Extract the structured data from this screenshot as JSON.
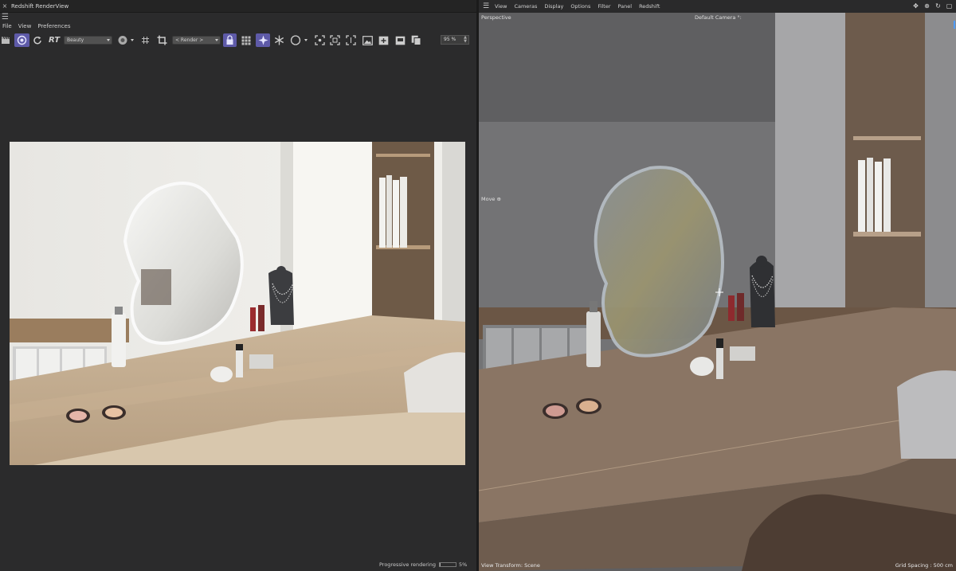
{
  "render_view": {
    "close_glyph": "×",
    "title": "Redshift RenderView",
    "menu": [
      "File",
      "View",
      "Preferences"
    ],
    "toolbar": {
      "rt_label": "RT",
      "aov_dropdown": "Beauty",
      "mode_dropdown": "< Render >",
      "zoom": "95 %"
    },
    "status": {
      "label": "Progressive rendering",
      "progress_percent": 5,
      "progress_text": "5%"
    }
  },
  "viewport": {
    "menu": [
      "View",
      "Cameras",
      "Display",
      "Options",
      "Filter",
      "Panel",
      "Redshift"
    ],
    "projection_label": "Perspective",
    "camera_label": "Default Camera",
    "camera_suffix": "°:",
    "tool_label": "Move",
    "tool_suffix": "⊕",
    "view_transform": "View Transform: Scene",
    "grid_spacing": "Grid Spacing : 500 cm"
  },
  "colors": {
    "accent_highlight": "#5e5aa8",
    "panel_bg": "#2b2b2c",
    "viewport_bg": "#5f5f61"
  }
}
